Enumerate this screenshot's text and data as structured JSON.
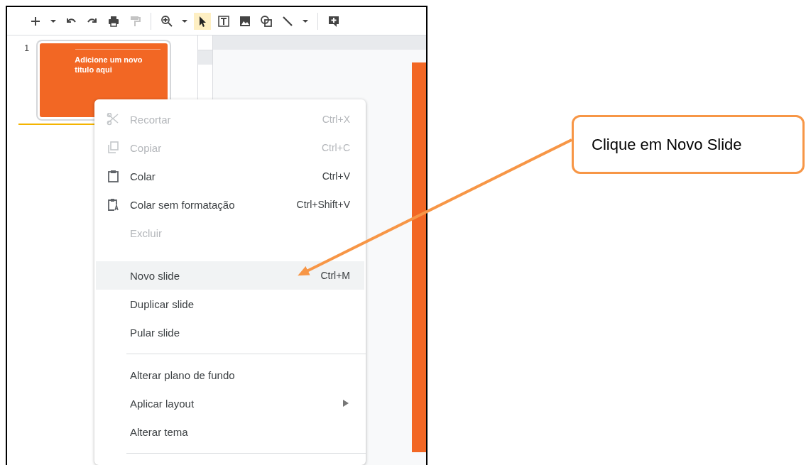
{
  "toolbar": {
    "tools": [
      {
        "selected": false
      },
      {
        "selected": false
      },
      {
        "selected": false
      },
      {
        "selected": false
      },
      {
        "selected": false
      },
      {
        "selected": false
      },
      {
        "selected": true
      },
      {
        "selected": false
      },
      {
        "selected": false
      },
      {
        "selected": false
      },
      {
        "selected": false
      },
      {
        "selected": false
      }
    ]
  },
  "filmstrip": {
    "slides": [
      {
        "number": "1",
        "title": "Adicione um novo titulo aqui",
        "selected": true
      }
    ]
  },
  "context_menu": {
    "items": [
      {
        "kind": "item",
        "label": "Recortar",
        "shortcut": "Ctrl+X",
        "disabled": true,
        "highlighted": false
      },
      {
        "kind": "item",
        "label": "Copiar",
        "shortcut": "Ctrl+C",
        "disabled": true,
        "highlighted": false
      },
      {
        "kind": "item",
        "label": "Colar",
        "shortcut": "Ctrl+V",
        "disabled": false,
        "highlighted": false
      },
      {
        "kind": "item",
        "label": "Colar sem formatação",
        "shortcut": "Ctrl+Shift+V",
        "disabled": false,
        "highlighted": false
      },
      {
        "kind": "item",
        "label": "Excluir",
        "disabled": true,
        "highlighted": false
      },
      {
        "kind": "gap"
      },
      {
        "kind": "item",
        "label": "Novo slide",
        "shortcut": "Ctrl+M",
        "disabled": false,
        "highlighted": true
      },
      {
        "kind": "item",
        "label": "Duplicar slide",
        "disabled": false,
        "highlighted": false
      },
      {
        "kind": "item",
        "label": "Pular slide",
        "disabled": false,
        "highlighted": false
      },
      {
        "kind": "divider"
      },
      {
        "kind": "item",
        "label": "Alterar plano de fundo",
        "disabled": false,
        "highlighted": false
      },
      {
        "kind": "item",
        "label": "Aplicar layout",
        "disabled": false,
        "highlighted": false,
        "submenu": true
      },
      {
        "kind": "item",
        "label": "Alterar tema",
        "disabled": false,
        "highlighted": false
      },
      {
        "kind": "divider"
      }
    ]
  },
  "callout": {
    "text": "Clique em Novo Slide"
  }
}
